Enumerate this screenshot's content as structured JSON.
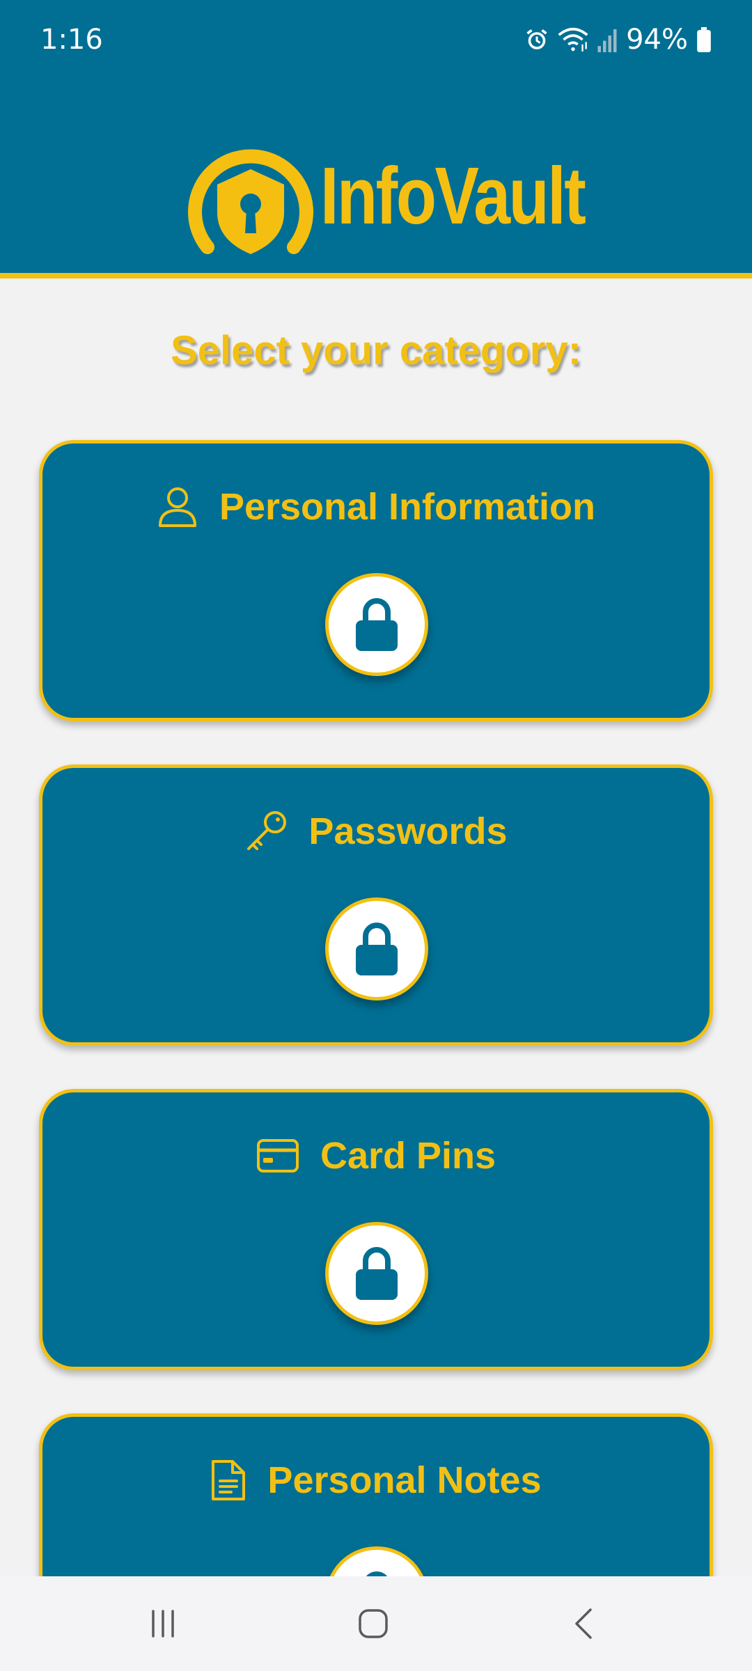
{
  "status_bar": {
    "time": "1:16",
    "battery": "94%",
    "icons": [
      "alarm-icon",
      "wifi-icon",
      "signal-icon",
      "battery-icon"
    ]
  },
  "header": {
    "app_name": "InfoVault",
    "logo_icon": "shield-keyhole-icon"
  },
  "main": {
    "title": "Select your category:",
    "categories": [
      {
        "label": "Personal Information",
        "icon": "person-icon",
        "action_icon": "lock-icon"
      },
      {
        "label": "Passwords",
        "icon": "key-icon",
        "action_icon": "lock-icon"
      },
      {
        "label": "Card Pins",
        "icon": "credit-card-icon",
        "action_icon": "lock-icon"
      },
      {
        "label": "Personal Notes",
        "icon": "document-icon",
        "action_icon": "lock-icon"
      }
    ]
  },
  "nav": {
    "items": [
      "recent-apps-icon",
      "home-icon",
      "back-icon"
    ]
  },
  "colors": {
    "primary": "#006f93",
    "accent": "#f2c014",
    "background": "#f2f2f2"
  }
}
